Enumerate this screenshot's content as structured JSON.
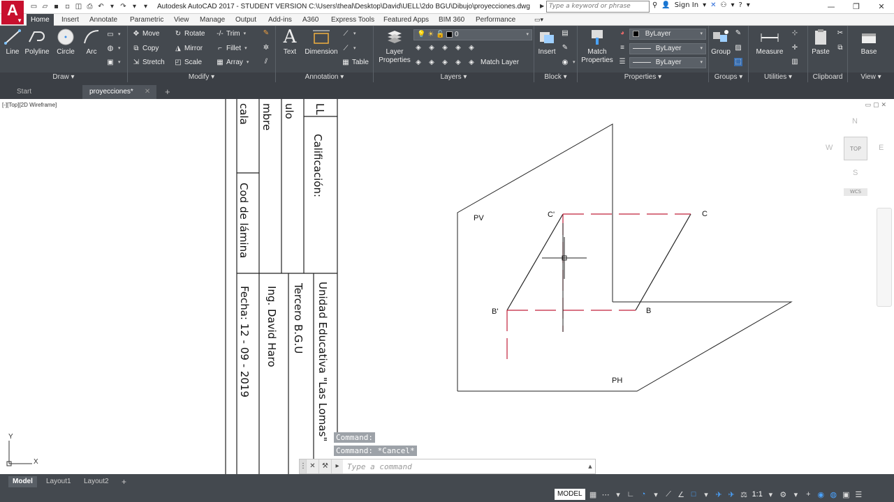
{
  "window": {
    "title": "Autodesk AutoCAD 2017 - STUDENT VERSION    C:\\Users\\theal\\Desktop\\David\\UELL\\2do BGU\\Dibujo\\proyecciones.dwg",
    "search_placeholder": "Type a keyword or phrase",
    "sign_in": "Sign In"
  },
  "ribbon_tabs": [
    "Home",
    "Insert",
    "Annotate",
    "Parametric",
    "View",
    "Manage",
    "Output",
    "Add-ins",
    "A360",
    "Express Tools",
    "Featured Apps",
    "BIM 360",
    "Performance"
  ],
  "ribbon": {
    "draw": {
      "title": "Draw",
      "line": "Line",
      "polyline": "Polyline",
      "circle": "Circle",
      "arc": "Arc"
    },
    "modify": {
      "title": "Modify",
      "move": "Move",
      "rotate": "Rotate",
      "trim": "Trim",
      "copy": "Copy",
      "mirror": "Mirror",
      "fillet": "Fillet",
      "stretch": "Stretch",
      "scale": "Scale",
      "array": "Array"
    },
    "annotation": {
      "title": "Annotation",
      "text": "Text",
      "dimension": "Dimension",
      "table": "Table"
    },
    "layers": {
      "title": "Layers",
      "layer_properties": "Layer Properties",
      "current_layer": "0",
      "match_layer": "Match Layer"
    },
    "block": {
      "title": "Block",
      "insert": "Insert"
    },
    "properties": {
      "title": "Properties",
      "match_properties": "Match Properties",
      "color": "ByLayer",
      "linetype": "ByLayer",
      "lineweight": "ByLayer"
    },
    "groups": {
      "title": "Groups",
      "group": "Group"
    },
    "utilities": {
      "title": "Utilities",
      "measure": "Measure"
    },
    "clipboard": {
      "title": "Clipboard",
      "paste": "Paste"
    },
    "view": {
      "title": "View",
      "base": "Base"
    }
  },
  "doc_tabs": {
    "start": "Start",
    "active": "proyecciones*"
  },
  "viewport": {
    "label": "[-][Top][2D Wireframe]"
  },
  "viewcube": {
    "n": "N",
    "s": "S",
    "e": "E",
    "w": "W",
    "top": "TOP",
    "wcs": "WCS"
  },
  "title_block": {
    "calificacion": "Calificación:",
    "cod_lamina": "Cod de lámina",
    "unidad": "Unidad Educativa \"Las Lomas\"",
    "curso": "Tercero B.G.U",
    "profesor": "Ing. David Haro",
    "fecha": "Fecha: 12 - 09 - 2019",
    "frag_escala": "cala",
    "frag_nombre": "mbre",
    "frag_titulo": "ulo",
    "frag_ll": "LL"
  },
  "drawing": {
    "pv": "PV",
    "ph": "PH",
    "c_prime": "C'",
    "c": "C",
    "b_prime": "B'",
    "b": "B",
    "ucs_x": "X",
    "ucs_y": "Y"
  },
  "command": {
    "history": [
      "Command:",
      "Command: *Cancel*"
    ],
    "placeholder": "Type a command"
  },
  "layout_tabs": [
    "Model",
    "Layout1",
    "Layout2"
  ],
  "status": {
    "model": "MODEL",
    "scale": "1:1"
  },
  "colors": {
    "ribbon": "#44494f",
    "accent": "#c8102e",
    "projection_line": "#c0203a"
  }
}
